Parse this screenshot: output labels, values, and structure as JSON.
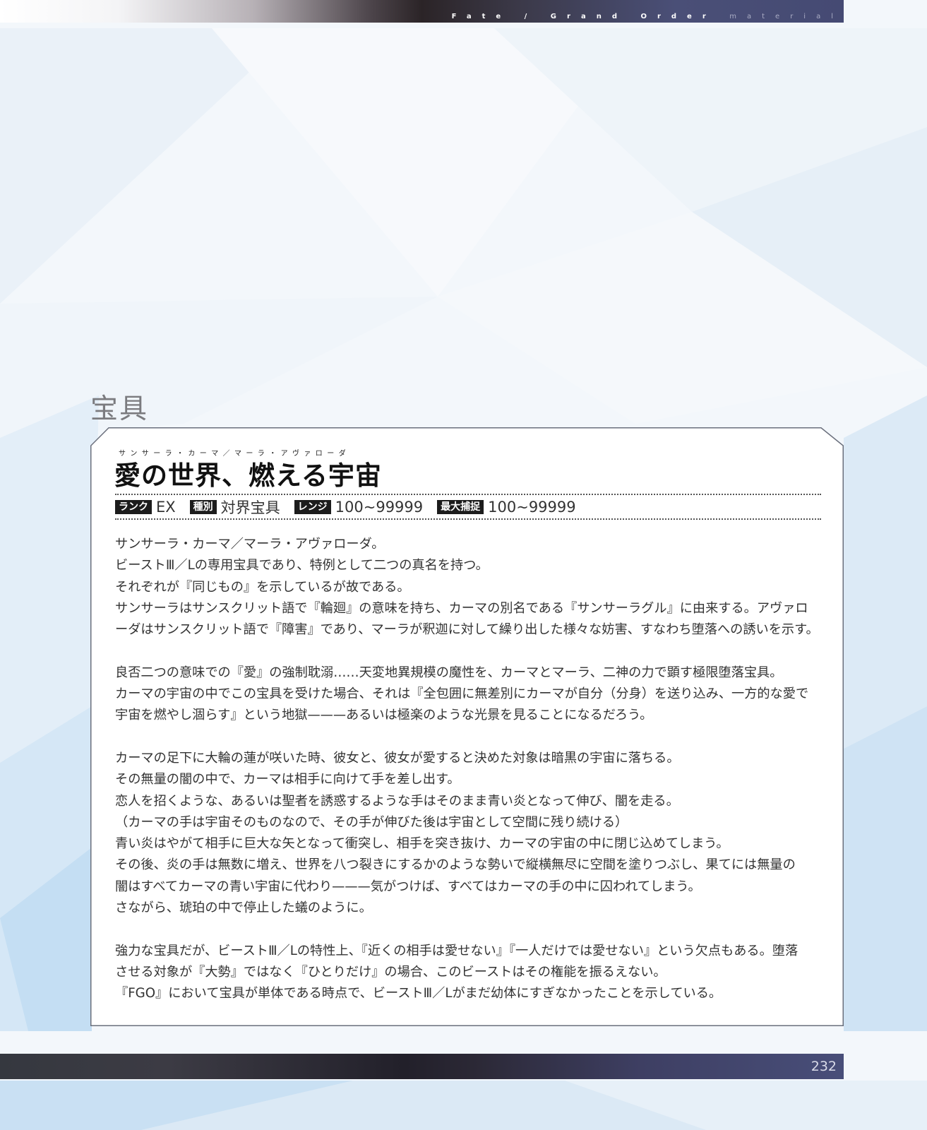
{
  "header": {
    "series_bold": "Fate / Grand Order",
    "series_light": "material"
  },
  "section": {
    "title": "宝具"
  },
  "noble_phantasm": {
    "ruby": "サンサーラ・カーマ／マーラ・アヴァローダ",
    "name": "愛の世界、燃える宇宙",
    "stats": [
      {
        "label": "ランク",
        "value": "EX"
      },
      {
        "label": "種別",
        "value": "対界宝具"
      },
      {
        "label": "レンジ",
        "value": "100~99999"
      },
      {
        "label": "最大捕捉",
        "value": "100~99999"
      }
    ],
    "paragraphs": [
      [
        "サンサーラ・カーマ／マーラ・アヴァローダ。",
        "ビーストⅢ／Lの専用宝具であり、特例として二つの真名を持つ。",
        "それぞれが『同じもの』を示しているが故である。",
        "サンサーラはサンスクリット語で『輪廻』の意味を持ち、カーマの別名である『サンサーラグル』に由来する。アヴァロ",
        "ーダはサンスクリット語で『障害』であり、マーラが釈迦に対して繰り出した様々な妨害、すなわち堕落への誘いを示す。"
      ],
      [
        "良否二つの意味での『愛』の強制耽溺……天変地異規模の魔性を、カーマとマーラ、二神の力で顕す極限堕落宝具。",
        "カーマの宇宙の中でこの宝具を受けた場合、それは『全包囲に無差別にカーマが自分（分身）を送り込み、一方的な愛で",
        "宇宙を燃やし涸らす』という地獄———あるいは極楽のような光景を見ることになるだろう。"
      ],
      [
        "カーマの足下に大輪の蓮が咲いた時、彼女と、彼女が愛すると決めた対象は暗黒の宇宙に落ちる。",
        "その無量の闇の中で、カーマは相手に向けて手を差し出す。",
        "恋人を招くような、あるいは聖者を誘惑するような手はそのまま青い炎となって伸び、闇を走る。",
        "（カーマの手は宇宙そのものなので、その手が伸びた後は宇宙として空間に残り続ける）",
        "青い炎はやがて相手に巨大な矢となって衝突し、相手を突き抜け、カーマの宇宙の中に閉じ込めてしまう。",
        "その後、炎の手は無数に増え、世界を八つ裂きにするかのような勢いで縦横無尽に空間を塗りつぶし、果てには無量の",
        "闇はすべてカーマの青い宇宙に代わり———気がつけば、すべてはカーマの手の中に囚われてしまう。",
        "さながら、琥珀の中で停止した蟻のように。"
      ],
      [
        "強力な宝具だが、ビーストⅢ／Lの特性上、『近くの相手は愛せない』『一人だけでは愛せない』という欠点もある。堕落",
        "させる対象が『大勢』ではなく『ひとりだけ』の場合、このビーストはその権能を振るえない。",
        "『FGO』において宝具が単体である時点で、ビーストⅢ／Lがまだ幼体にすぎなかったことを示している。"
      ]
    ]
  },
  "footer": {
    "page_number": "232"
  }
}
